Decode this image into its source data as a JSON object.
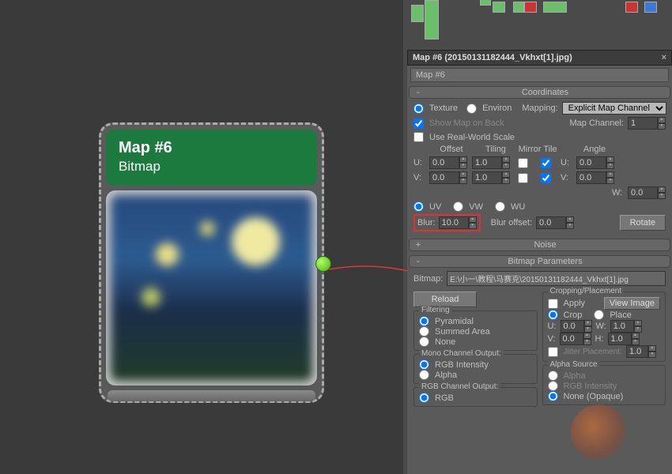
{
  "watermark": "",
  "node": {
    "title": "Map #6",
    "type": "Bitmap"
  },
  "panel_title": "Map #6 (20150131182444_Vkhxt[1].jpg)",
  "name_field": "Map #6",
  "coordinates": {
    "title": "Coordinates",
    "texture": "Texture",
    "environ": "Environ",
    "mapping_label": "Mapping:",
    "mapping_value": "Explicit Map Channel",
    "show_map": "Show Map on Back",
    "real_world": "Use Real-World Scale",
    "map_channel_label": "Map Channel:",
    "map_channel_value": "1",
    "offset_h": "Offset",
    "tiling_h": "Tiling",
    "mirror_h": "Mirror",
    "tile_h": "Tile",
    "angle_h": "Angle",
    "u_label": "U:",
    "v_label": "V:",
    "w_label": "W:",
    "u_off": "0.0",
    "v_off": "0.0",
    "u_til": "1.0",
    "v_til": "1.0",
    "u_ang": "0.0",
    "v_ang": "0.0",
    "w_ang": "0.0",
    "uv": "UV",
    "vw": "VW",
    "wu": "WU",
    "blur_label": "Blur:",
    "blur_value": "10.0",
    "blur_off_label": "Blur offset:",
    "blur_off_value": "0.0",
    "rotate": "Rotate"
  },
  "noise": {
    "title": "Noise"
  },
  "bitmap_params": {
    "title": "Bitmap Parameters",
    "bitmap_label": "Bitmap:",
    "bitmap_path": "E:\\小一\\教程\\马赛克\\20150131182444_Vkhxt[1].jpg",
    "reload": "Reload",
    "filtering": {
      "title": "Filtering",
      "pyramidal": "Pyramidal",
      "summed": "Summed Area",
      "none": "None"
    },
    "mono": {
      "title": "Mono Channel Output:",
      "rgb_int": "RGB Intensity",
      "alpha": "Alpha"
    },
    "rgb_out": {
      "title": "RGB Channel Output:",
      "rgb": "RGB"
    },
    "crop": {
      "title": "Cropping/Placement",
      "apply": "Apply",
      "view": "View Image",
      "crop": "Crop",
      "place": "Place",
      "u": "U:",
      "v": "V:",
      "w": "W:",
      "h": "H:",
      "u_val": "0.0",
      "v_val": "0.0",
      "w_val": "1.0",
      "h_val": "1.0",
      "jitter": "Jitter Placement:",
      "jitter_val": "1.0"
    },
    "alpha_src": {
      "title": "Alpha Source",
      "alpha": "Alpha",
      "rgb_int": "RGB Intensity",
      "none": "None (Opaque)"
    }
  }
}
